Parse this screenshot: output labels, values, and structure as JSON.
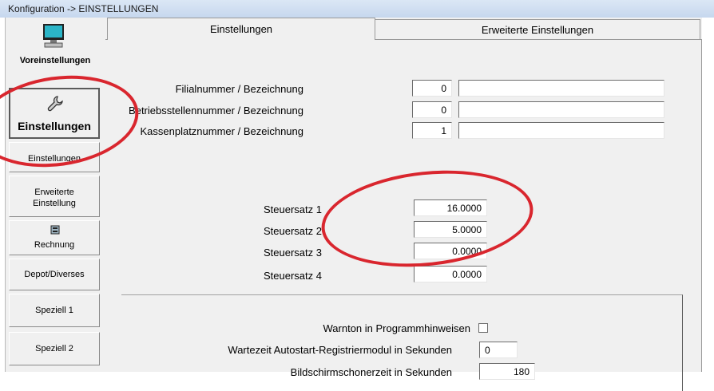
{
  "window": {
    "title": "Konfiguration -> EINSTELLUNGEN"
  },
  "sidebar": {
    "voreinstellungen": "Voreinstellungen",
    "einstellungen_main": "Einstellungen",
    "einstellungen_sub": "Einstellungen",
    "erweiterte_line1": "Erweiterte",
    "erweiterte_line2": "Einstellung",
    "rechnung": "Rechnung",
    "depot": "Depot/Diverses",
    "speziell1": "Speziell 1",
    "speziell2": "Speziell 2"
  },
  "tabs": {
    "einstellungen": "Einstellungen",
    "erweiterte": "Erweiterte Einstellungen"
  },
  "form": {
    "filial_label": "Filialnummer / Bezeichnung",
    "filial_value": "0",
    "filial_name": "",
    "betrieb_label": "Betriebsstellennummer / Bezeichnung",
    "betrieb_value": "0",
    "betrieb_name": "",
    "kassen_label": "Kassenplatznummer / Bezeichnung",
    "kassen_value": "1",
    "kassen_name": ""
  },
  "tax": {
    "s1_label": "Steuersatz 1",
    "s1_value": "16.0000",
    "s2_label": "Steuersatz 2",
    "s2_value": "5.0000",
    "s3_label": "Steuersatz 3",
    "s3_value": "0.0000",
    "s4_label": "Steuersatz 4",
    "s4_value": "0.0000"
  },
  "group": {
    "warnton_label": "Warnton in Programmhinweisen",
    "warnton_checked": false,
    "wartezeit_label": "Wartezeit Autostart-Registriermodul in Sekunden",
    "wartezeit_value": "0",
    "bildschirm_label": "Bildschirmschonerzeit in Sekunden",
    "bildschirm_value": "180"
  },
  "colors": {
    "annotation": "#d9262e",
    "window_bg": "#f0f0f0"
  }
}
